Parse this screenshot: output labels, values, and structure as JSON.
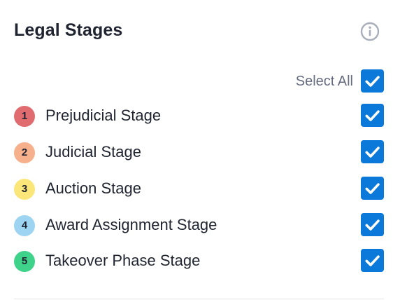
{
  "panel": {
    "title": "Legal Stages",
    "info_icon": "info-circle-icon",
    "select_all": {
      "label": "Select All",
      "checked": true
    },
    "stages": [
      {
        "number": "1",
        "label": "Prejudicial Stage",
        "color": "#e06c6f",
        "checked": true
      },
      {
        "number": "2",
        "label": "Judicial Stage",
        "color": "#f7b08c",
        "checked": true
      },
      {
        "number": "3",
        "label": "Auction Stage",
        "color": "#fbe67a",
        "checked": true
      },
      {
        "number": "4",
        "label": "Award Assignment Stage",
        "color": "#9dd4f2",
        "checked": true
      },
      {
        "number": "5",
        "label": "Takeover Phase Stage",
        "color": "#3fd28a",
        "checked": true
      }
    ],
    "colors": {
      "checkbox": "#0b79d9",
      "title": "#1f2430",
      "muted": "#666c80",
      "info_icon": "#a9aebb"
    }
  }
}
